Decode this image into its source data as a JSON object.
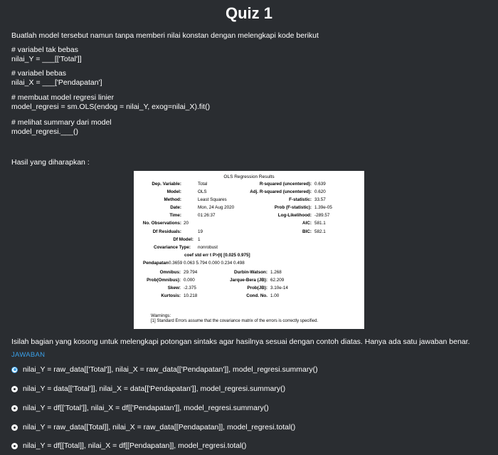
{
  "quiz": {
    "title": "Quiz 1",
    "instruction": "Buatlah model tersebut namun tanpa memberi nilai konstan dengan melengkapi kode berikut",
    "code": [
      "# variabel tak bebas",
      "nilai_Y = ___[['Total']]",
      "# variabel bebas",
      "nilai_X = ___['Pendapatan']",
      "# membuat model regresi linier",
      "model_regresi = sm.OLS(endog = nilai_Y, exog=nilai_X).fit()",
      "# melihat summary dari model",
      "model_regresi.___()"
    ],
    "expected_label": "Hasil yang diharapkan :",
    "question": "Isilah bagian yang kosong untuk melengkapi potongan sintaks agar hasilnya sesuai dengan contoh diatas. Hanya ada satu jawaban benar.",
    "answer_header": "JAWABAN",
    "options": [
      {
        "label": "nilai_Y = raw_data[['Total']], nilai_X = raw_data[['Pendapatan']], model_regresi.summary()",
        "selected": true
      },
      {
        "label": "nilai_Y = data[['Total']], nilai_X = data[['Pendapatan']], model_regresi.summary()",
        "selected": false
      },
      {
        "label": "nilai_Y = df[['Total']], nilai_X = df[['Pendapatan']], model_regresi.summary()",
        "selected": false
      },
      {
        "label": "nilai_Y = raw_data[[Total]], nilai_X = raw_data[[Pendapatan]], model_regresi.total()",
        "selected": false
      },
      {
        "label": "nilai_Y = df[[Total]], nilai_X = df[[Pendapatan]], model_regresi.total()",
        "selected": false
      }
    ]
  },
  "ols": {
    "title": "OLS Regression Results",
    "left": [
      {
        "label": "Dep. Variable:",
        "value": "Total"
      },
      {
        "label": "Model:",
        "value": "OLS"
      },
      {
        "label": "Method:",
        "value": "Least Squares"
      },
      {
        "label": "Date:",
        "value": "Mon, 24 Aug 2020"
      },
      {
        "label": "Time:",
        "value": "01:26:37"
      },
      {
        "label": "No. Observations:",
        "value": "20"
      },
      {
        "label": "Df Residuals:",
        "value": "19"
      },
      {
        "label": "Df Model:",
        "value": "1"
      },
      {
        "label": "Covariance Type:",
        "value": "nonrobust"
      }
    ],
    "right": [
      {
        "label": "R-squared (uncentered):",
        "value": "0.639"
      },
      {
        "label": "Adj. R-squared (uncentered):",
        "value": "0.620"
      },
      {
        "label": "F-statistic:",
        "value": "33.57"
      },
      {
        "label": "Prob (F-statistic):",
        "value": "1.39e-05"
      },
      {
        "label": "Log-Likelihood:",
        "value": "-289.57"
      },
      {
        "label": "AIC:",
        "value": "581.1"
      },
      {
        "label": "BIC:",
        "value": "582.1"
      }
    ],
    "coef_header": "coef   std err   t   P>|t|  [0.025 0.975]",
    "coef_row_label": "Pendapatan",
    "coef_row_values": "0.3659 0.063   5.794 0.000 0.234   0.498",
    "diag": [
      {
        "l1": "Omnibus:",
        "v1": "29.794",
        "l2": "Durbin-Watson:",
        "v2": "1.268"
      },
      {
        "l1": "Prob(Omnibus):",
        "v1": "0.000",
        "l2": "Jarque-Bera (JB):",
        "v2": "62.209"
      },
      {
        "l1": "Skew:",
        "v1": "-2.375",
        "l2": "Prob(JB):",
        "v2": "3.10e-14"
      },
      {
        "l1": "Kurtosis:",
        "v1": "10.218",
        "l2": "Cond. No.",
        "v2": "1.00"
      }
    ],
    "warnings_title": "Warnings:",
    "warnings_text": "[1] Standard Errors assume that the covariance matrix of the errors is correctly specified."
  }
}
